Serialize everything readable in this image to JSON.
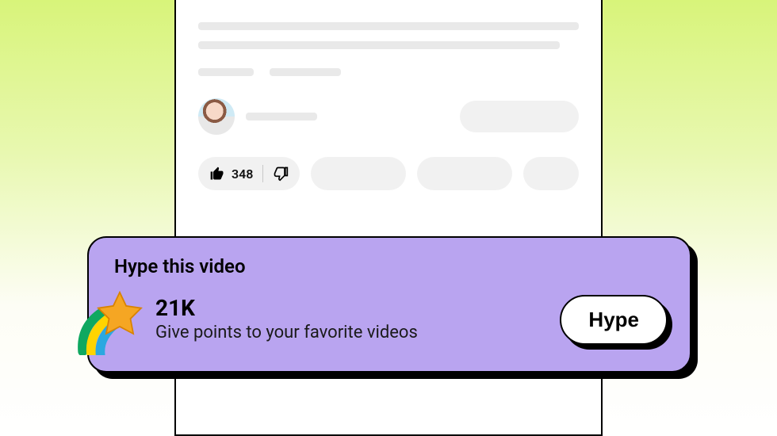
{
  "video": {
    "like_count": "348"
  },
  "hype": {
    "title": "Hype this video",
    "count": "21K",
    "subtitle": "Give points to your favorite videos",
    "button_label": "Hype"
  },
  "colors": {
    "banner_bg": "#b9a4f0",
    "pill_bg": "#f1f1f1"
  }
}
